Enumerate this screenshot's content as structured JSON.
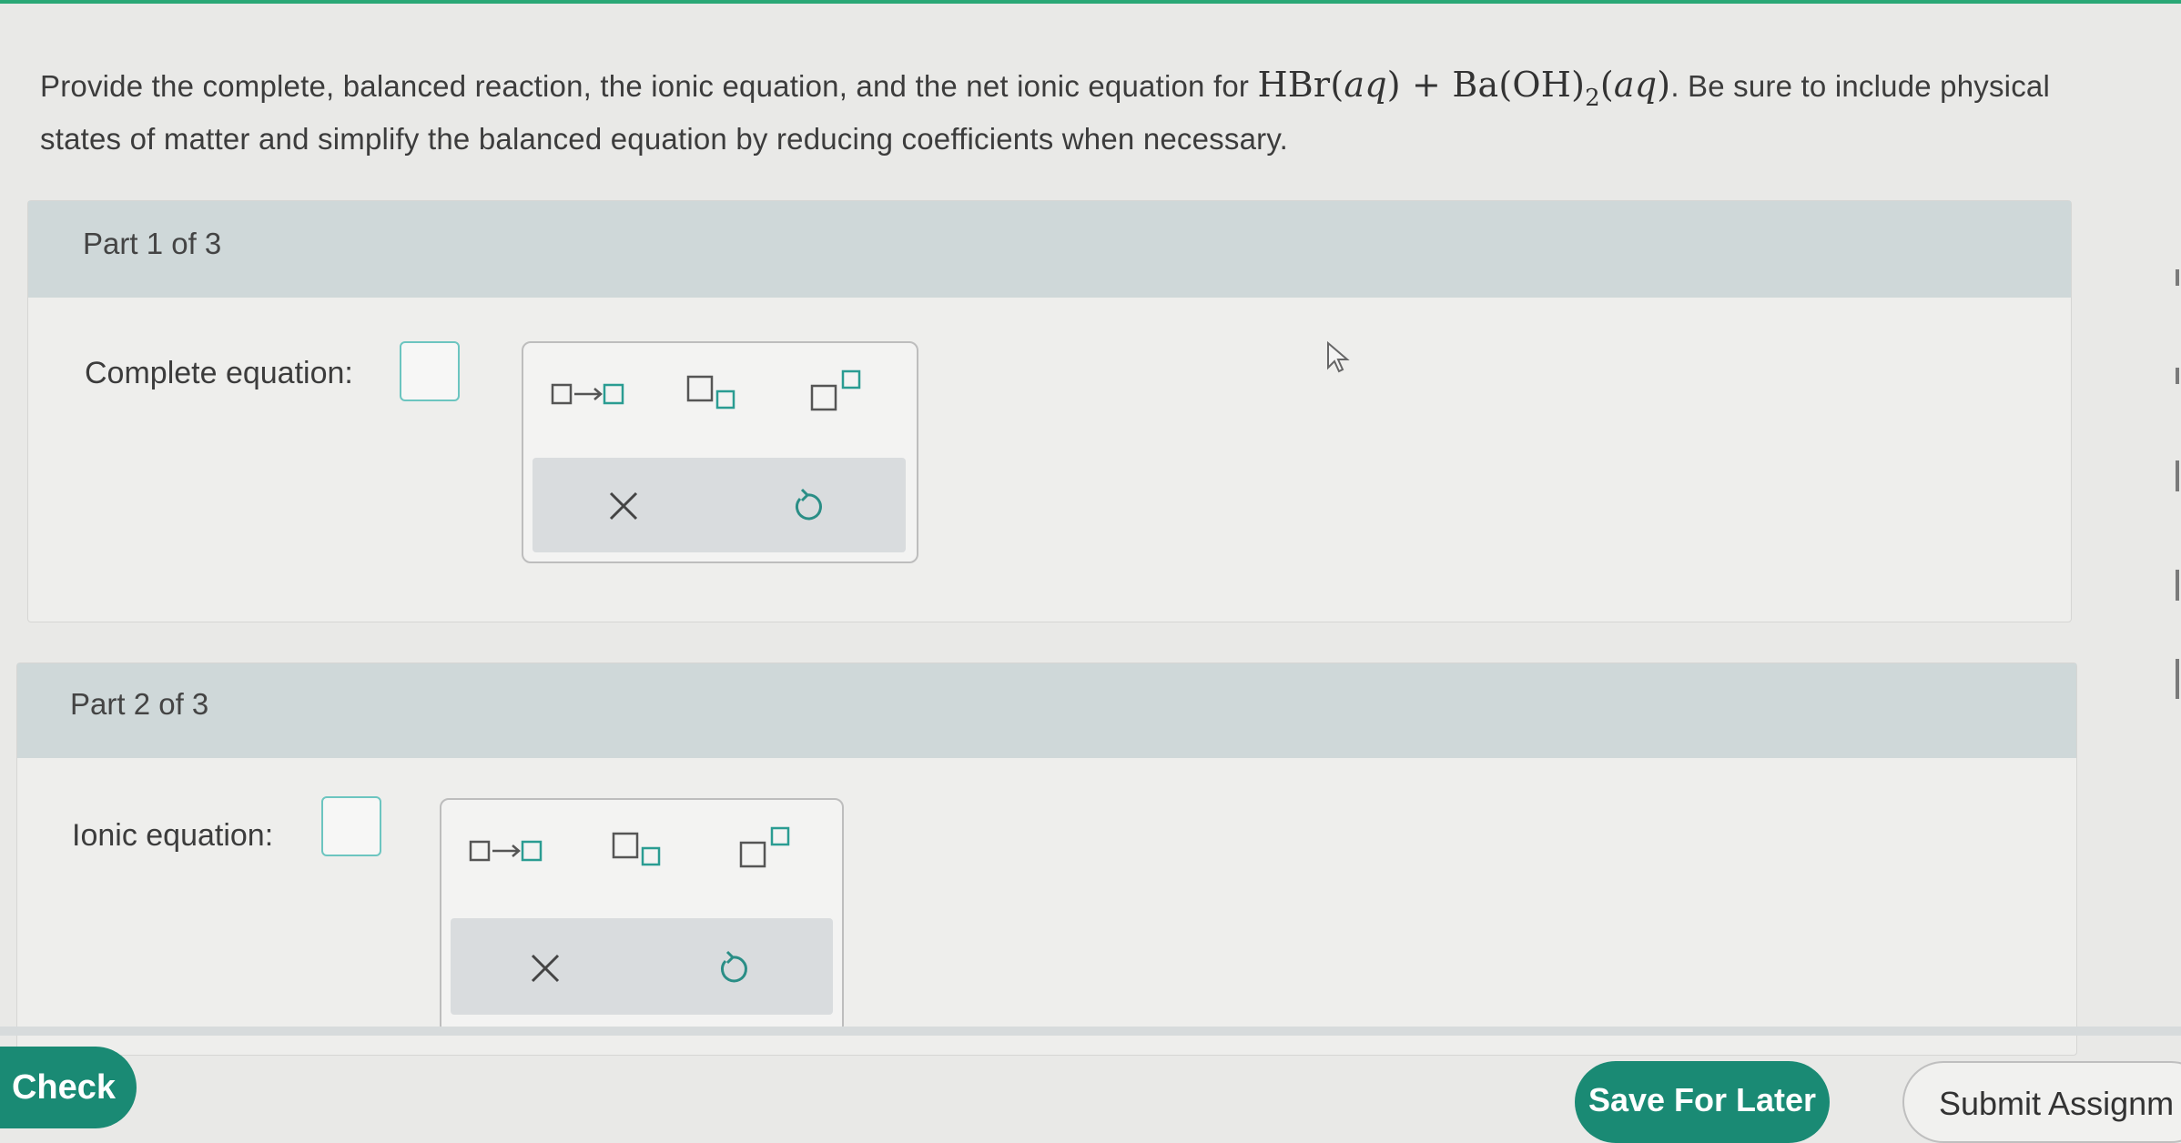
{
  "question": {
    "intro": "Provide the complete, balanced reaction, the ionic equation, and the net ionic equation for",
    "formula": {
      "reactant1_formula": "HBr",
      "reactant1_state": "aq",
      "plus": "+",
      "reactant2_formula_a": "Ba(OH)",
      "reactant2_subscript": "2",
      "reactant2_state": "aq"
    },
    "outro": ". Be sure to include physical states of matter and simplify the balanced equation by reducing coefficients when necessary."
  },
  "parts": [
    {
      "header": "Part 1 of 3",
      "label": "Complete equation:",
      "tools": [
        "arrow-template-icon",
        "subscript-template-icon",
        "superscript-template-icon",
        "clear-icon",
        "undo-icon"
      ]
    },
    {
      "header": "Part 2 of 3",
      "label": "Ionic equation:",
      "tools": [
        "arrow-template-icon",
        "subscript-template-icon",
        "superscript-template-icon",
        "clear-icon",
        "undo-icon"
      ]
    }
  ],
  "footer": {
    "check_label": "Check",
    "save_label": "Save For Later",
    "submit_label": "Submit Assignm"
  },
  "colors": {
    "accent": "#1a8a74",
    "part_header": "#cfd8d9",
    "answer_box_border": "#6cc5c0",
    "top_accent": "#2aa876"
  }
}
